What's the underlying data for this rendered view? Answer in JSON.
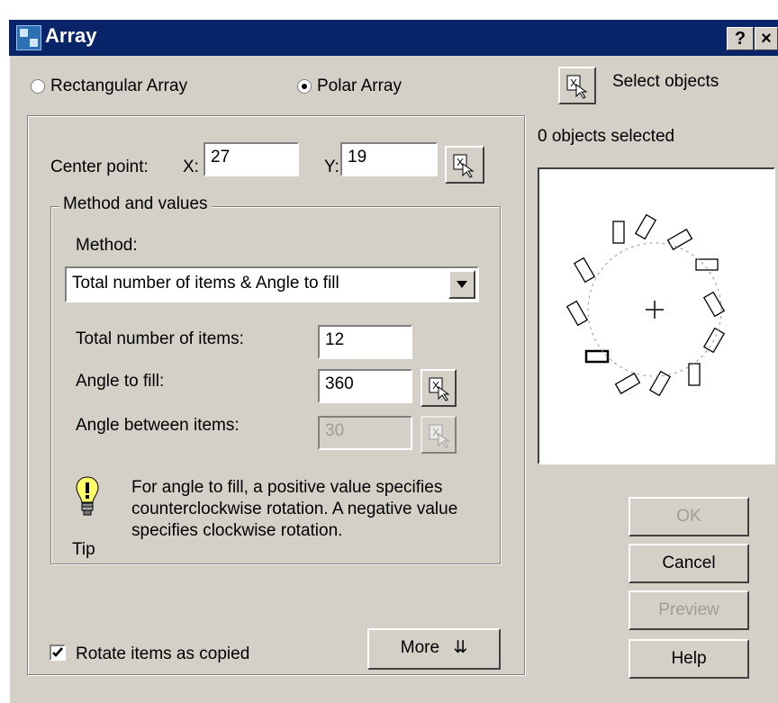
{
  "window": {
    "title": "Array",
    "help_button": "?",
    "close_button": "×"
  },
  "array_type": {
    "rectangular_label": "Rectangular Array",
    "polar_label": "Polar Array",
    "selected": "polar"
  },
  "select_objects": {
    "label": "Select objects",
    "status": "0 objects selected"
  },
  "center_point": {
    "label": "Center point:",
    "x_label": "X:",
    "x_value": "27",
    "y_label": "Y:",
    "y_value": "19"
  },
  "method_group": {
    "title": "Method and values",
    "method_label": "Method:",
    "method_value": "Total number of items & Angle to fill",
    "total_items_label": "Total number of items:",
    "total_items_value": "12",
    "angle_fill_label": "Angle to fill:",
    "angle_fill_value": "360",
    "angle_between_label": "Angle between items:",
    "angle_between_value": "30",
    "tip_text": "For angle to fill, a positive value specifies counterclockwise rotation.  A negative value specifies clockwise rotation.",
    "tip_label": "Tip"
  },
  "rotate_items": {
    "label": "Rotate items as copied",
    "checked": true
  },
  "buttons": {
    "more": "More",
    "ok": "OK",
    "cancel": "Cancel",
    "preview": "Preview",
    "help": "Help"
  },
  "colors": {
    "title_bar": "#0a246a",
    "dialog": "#d4d0c8",
    "disabled_text": "#a09c94"
  }
}
